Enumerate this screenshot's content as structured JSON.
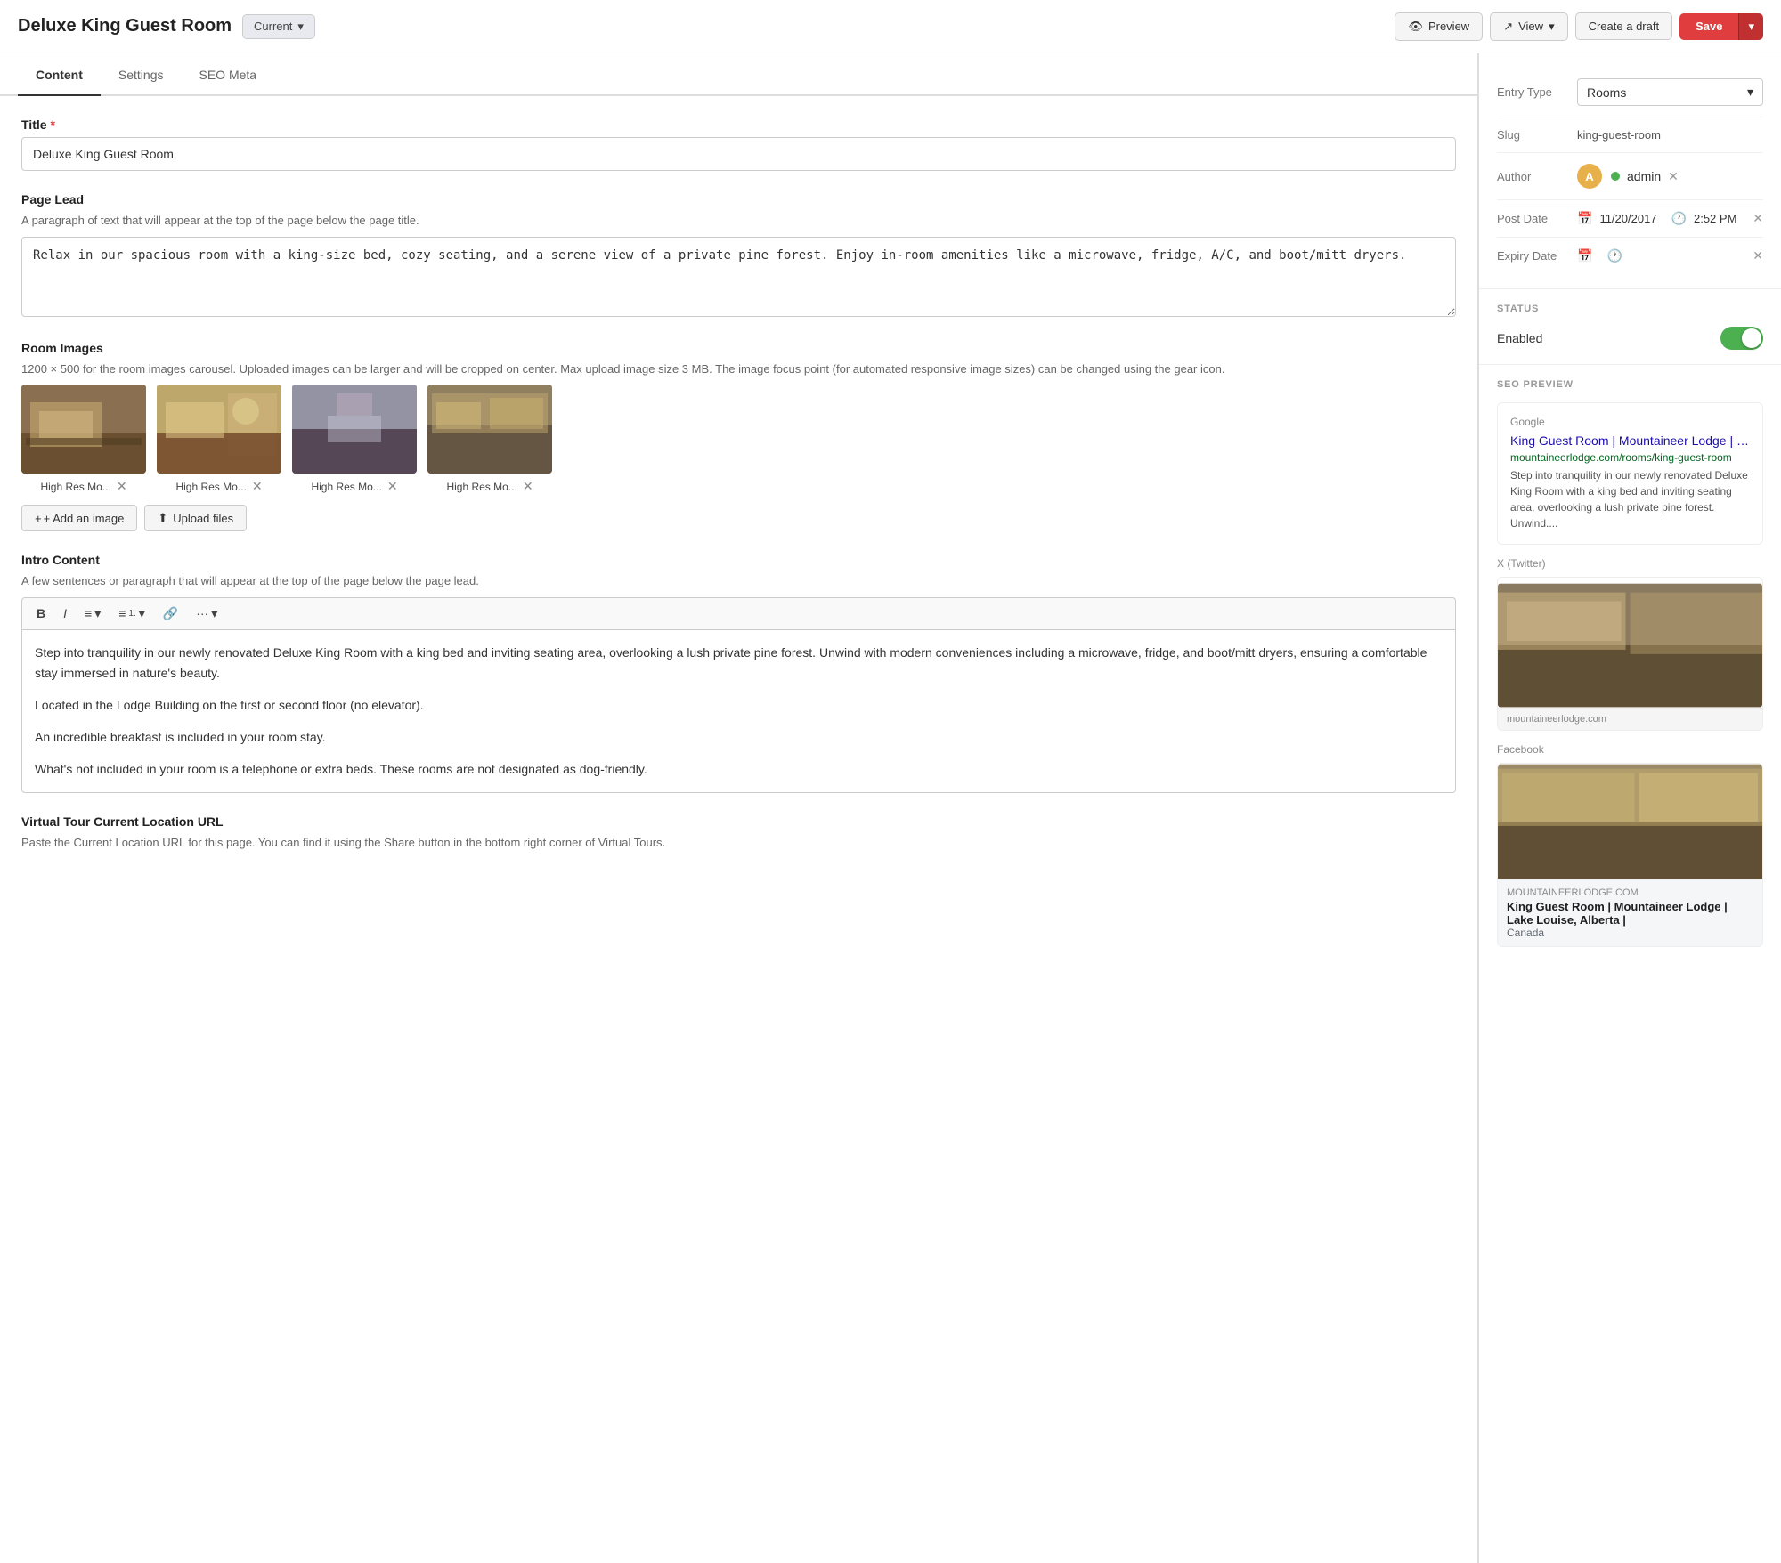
{
  "header": {
    "page_title": "Deluxe King Guest Room",
    "status_badge": "Current",
    "btn_preview": "Preview",
    "btn_view": "View",
    "btn_create_draft": "Create a draft",
    "btn_save": "Save"
  },
  "tabs": [
    {
      "label": "Content",
      "active": true
    },
    {
      "label": "Settings",
      "active": false
    },
    {
      "label": "SEO Meta",
      "active": false
    }
  ],
  "content": {
    "title_label": "Title",
    "title_value": "Deluxe King Guest Room",
    "page_lead_label": "Page Lead",
    "page_lead_desc": "A paragraph of text that will appear at the top of the page below the page title.",
    "page_lead_value": "Relax in our spacious room with a king-size bed, cozy seating, and a serene view of a private pine forest. Enjoy in-room amenities like a microwave, fridge, A/C, and boot/mitt dryers.",
    "room_images_label": "Room Images",
    "room_images_desc": "1200 × 500 for the room images carousel. Uploaded images can be larger and will be cropped on center. Max upload image size 3 MB. The image focus point (for automated responsive image sizes) can be changed using the gear icon.",
    "images": [
      {
        "label": "High Res Mo...",
        "id": "img1"
      },
      {
        "label": "High Res Mo...",
        "id": "img2"
      },
      {
        "label": "High Res Mo...",
        "id": "img3"
      },
      {
        "label": "High Res Mo...",
        "id": "img4"
      }
    ],
    "btn_add_image": "+ Add an image",
    "btn_upload": "Upload files",
    "intro_content_label": "Intro Content",
    "intro_content_desc": "A few sentences or paragraph that will appear at the top of the page below the page lead.",
    "intro_text_p1": "Step into tranquility in our newly renovated Deluxe King Room with a king bed and inviting seating area, overlooking a lush private pine forest. Unwind with modern conveniences including a microwave, fridge, and boot/mitt dryers, ensuring a comfortable stay immersed in nature's beauty.",
    "intro_text_p2": "Located in the Lodge Building on the first or second floor (no elevator).",
    "intro_text_p3": "An incredible breakfast is included in your room stay.",
    "intro_text_p4": "What's not included in your room is a telephone or extra beds. These rooms are not designated as dog-friendly.",
    "virtual_tour_label": "Virtual Tour Current Location URL",
    "virtual_tour_desc": "Paste the Current Location URL for this page. You can find it using the Share button in the bottom right corner of Virtual Tours."
  },
  "sidebar": {
    "entry_type_label": "Entry Type",
    "entry_type_value": "Rooms",
    "slug_label": "Slug",
    "slug_value": "king-guest-room",
    "author_label": "Author",
    "author_name": "admin",
    "author_initial": "A",
    "post_date_label": "Post Date",
    "post_date_value": "11/20/2017",
    "post_time_value": "2:52 PM",
    "expiry_date_label": "Expiry Date",
    "status_section_label": "STATUS",
    "status_value": "Enabled",
    "seo_section_label": "SEO PREVIEW",
    "seo_google_source": "Google",
    "seo_google_title": "King Guest Room | Mountaineer Lodge | Lake Louise, Alberta | ...",
    "seo_google_url": "mountaineerlodge.com/rooms/king-guest-room",
    "seo_google_desc": "Step into tranquility in our newly renovated Deluxe King Room with a king bed and inviting seating area, overlooking a lush private pine forest. Unwind....",
    "seo_twitter_source": "X (Twitter)",
    "seo_twitter_site": "mountaineerlodge.com",
    "seo_facebook_source": "Facebook",
    "seo_fb_site": "MOUNTAINEERLODGE.COM",
    "seo_fb_title": "King Guest Room | Mountaineer Lodge | Lake Louise, Alberta |",
    "seo_fb_subtitle": "Canada"
  }
}
